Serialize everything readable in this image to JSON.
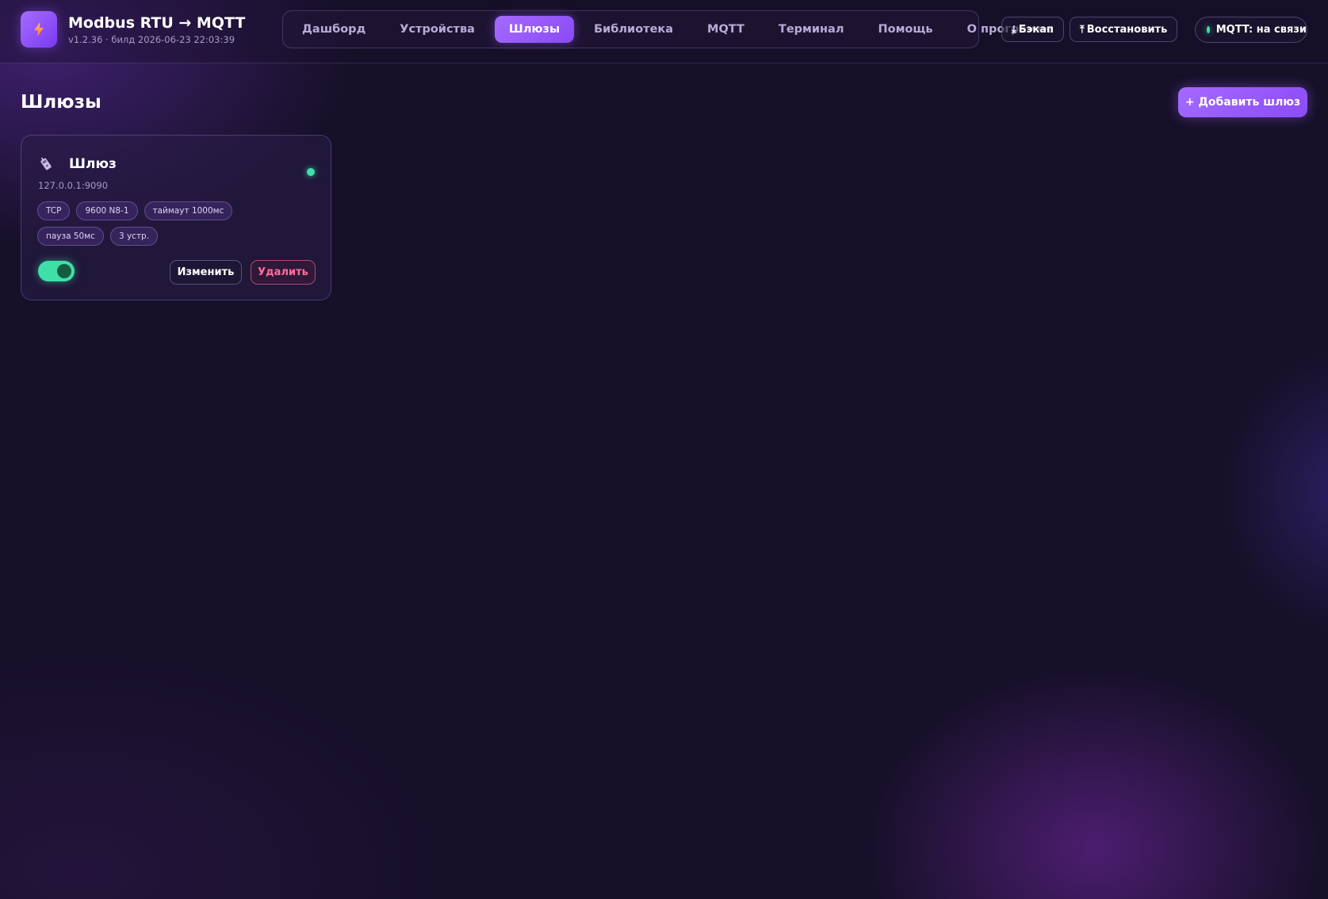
{
  "app": {
    "title": "Modbus RTU → MQTT",
    "build": "v1.2.36 · билд 2026-06-23 22:03:39",
    "icon": "lightning-icon",
    "accent_color": "#9b5cff",
    "online_color": "#3ee0a8",
    "danger_color": "#ff6e9e"
  },
  "nav": {
    "tabs": [
      {
        "label": "Дашборд",
        "active": false
      },
      {
        "label": "Устройства",
        "active": false
      },
      {
        "label": "Шлюзы",
        "active": true
      },
      {
        "label": "Библиотека",
        "active": false
      },
      {
        "label": "MQTT",
        "active": false
      },
      {
        "label": "Терминал",
        "active": false
      },
      {
        "label": "Помощь",
        "active": false
      },
      {
        "label": "О программе",
        "active": false
      }
    ]
  },
  "header": {
    "backup_label": "Бэкап",
    "backup_glyph": "⤓",
    "restore_label": "Восстановить",
    "restore_glyph": "⤒",
    "mqtt_status": "MQTT: на связи"
  },
  "page": {
    "title": "Шлюзы",
    "add_button": "+ Добавить шлюз"
  },
  "gateways": [
    {
      "name": "Шлюз",
      "icon": "gateway-icon",
      "address": "127.0.0.1:9090",
      "online": true,
      "enabled": true,
      "tags": [
        "TCP",
        "9600 N8-1",
        "таймаут 1000мс",
        "пауза 50мс",
        "3 устр."
      ],
      "edit_label": "Изменить",
      "delete_label": "Удалить"
    }
  ]
}
